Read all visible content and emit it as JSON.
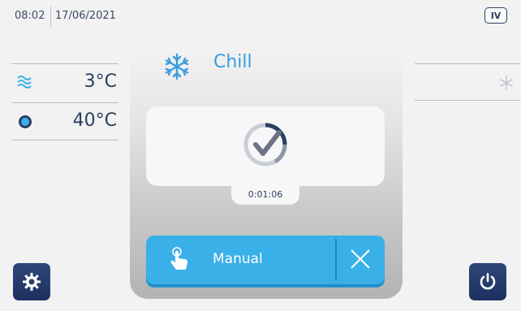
{
  "header": {
    "time": "08:02",
    "date": "17/06/2021",
    "mode_badge": "IV"
  },
  "readings": {
    "air": {
      "icon": "air-waves-icon",
      "value": "3°C"
    },
    "probe": {
      "icon": "probe-dot-icon",
      "value": "40°C"
    }
  },
  "cycle": {
    "icon": "snowflake-icon",
    "label": "Chill",
    "status_icon": "check-circle-icon",
    "timer": "0:01:06"
  },
  "manual_button": {
    "label": "Manual",
    "icon": "hand-pointer-icon",
    "cancel_icon": "close-icon"
  },
  "colors": {
    "accent_blue": "#3ab0e8",
    "dark_navy": "#1d3160",
    "text_navy": "#2a3f63"
  }
}
